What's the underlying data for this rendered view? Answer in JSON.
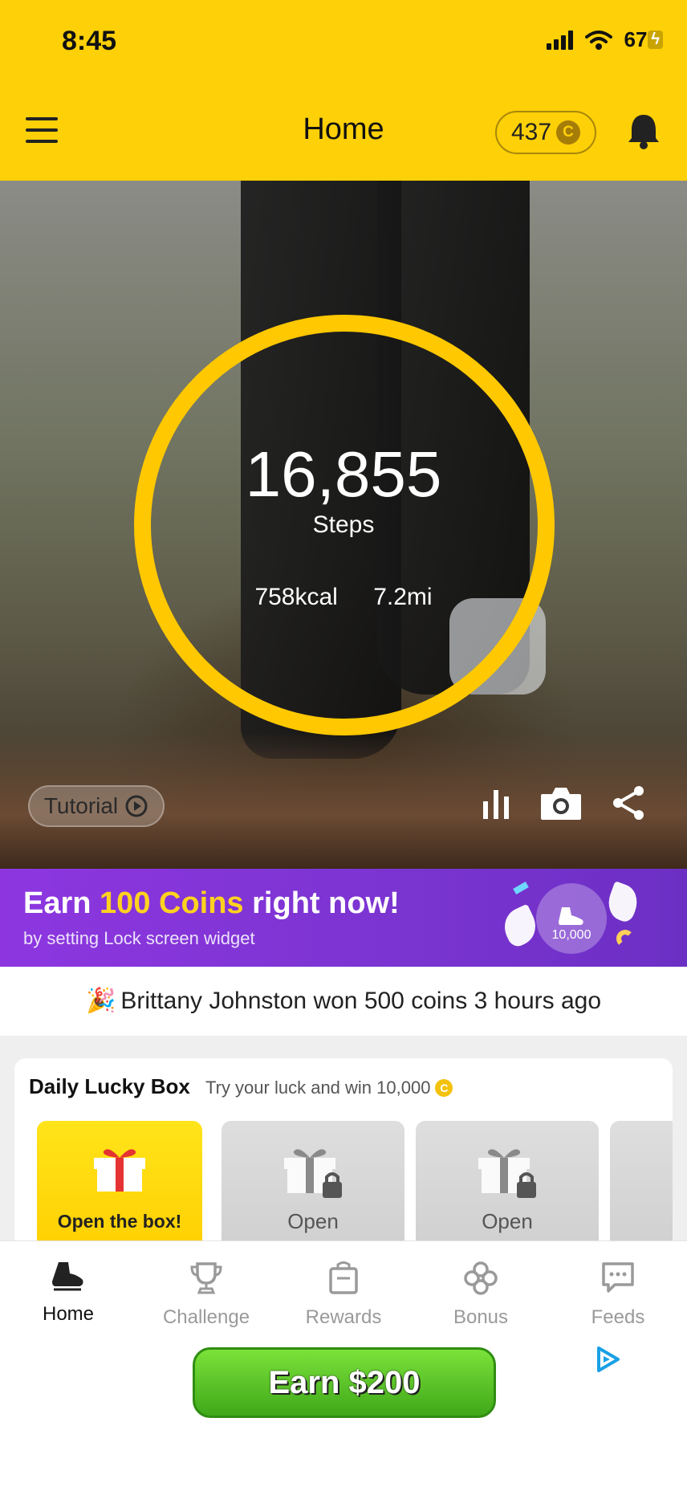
{
  "status_bar": {
    "time": "8:45",
    "battery": "67"
  },
  "header": {
    "title": "Home",
    "coins": "437",
    "coin_symbol": "C"
  },
  "hero": {
    "steps": "16,855",
    "steps_label": "Steps",
    "kcal": "758kcal",
    "distance": "7.2mi",
    "tutorial_label": "Tutorial",
    "ring_color": "#ffc800"
  },
  "promo": {
    "title_prefix": "Earn ",
    "title_highlight": "100 Coins",
    "title_suffix": " right now!",
    "subtitle": "by setting Lock screen widget",
    "badge_value": "10,000"
  },
  "winner": {
    "emoji": "🎉",
    "text": "Brittany Johnston won 500 coins 3 hours ago"
  },
  "lucky_box": {
    "title": "Daily Lucky Box",
    "subtitle": "Try your luck and win 10,000",
    "coin_symbol": "C",
    "boxes": [
      {
        "label": "Open the box!"
      },
      {
        "label": "Open"
      },
      {
        "label": "Open"
      }
    ]
  },
  "nav": {
    "items": [
      {
        "label": "Home",
        "icon": "shoe-icon"
      },
      {
        "label": "Challenge",
        "icon": "trophy-icon"
      },
      {
        "label": "Rewards",
        "icon": "bag-icon"
      },
      {
        "label": "Bonus",
        "icon": "clover-icon"
      },
      {
        "label": "Feeds",
        "icon": "chat-icon"
      }
    ]
  },
  "ad": {
    "button_label": "Earn $200"
  },
  "colors": {
    "brand_yellow": "#fdd007",
    "promo_purple": "#8d36e0",
    "ad_green": "#4fc020"
  }
}
